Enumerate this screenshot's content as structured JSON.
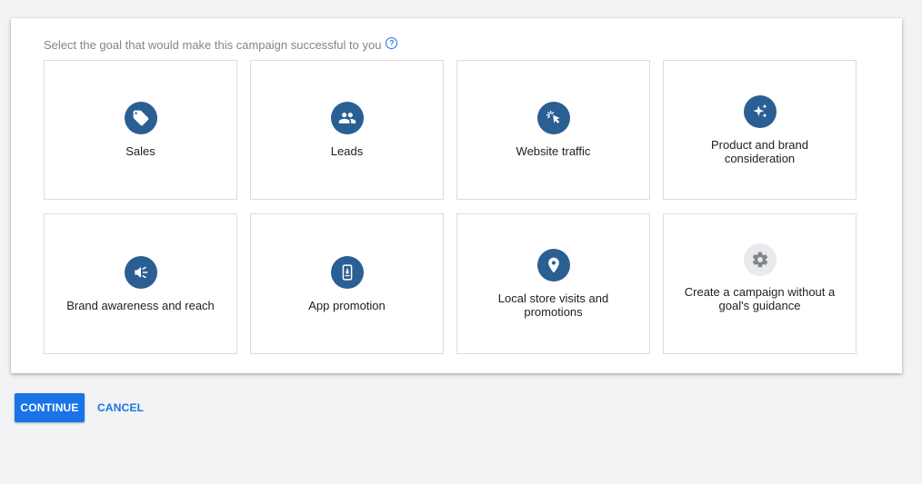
{
  "prompt": {
    "text": "Select the goal that would make this campaign successful to you",
    "help_glyph": "?"
  },
  "goals": [
    {
      "label": "Sales",
      "icon": "tag-icon"
    },
    {
      "label": "Leads",
      "icon": "people-icon"
    },
    {
      "label": "Website traffic",
      "icon": "cursor-click-icon"
    },
    {
      "label": "Product and brand consideration",
      "icon": "sparkle-icon"
    },
    {
      "label": "Brand awareness and reach",
      "icon": "megaphone-icon"
    },
    {
      "label": "App promotion",
      "icon": "phone-download-icon"
    },
    {
      "label": "Local store visits and promotions",
      "icon": "location-pin-icon"
    },
    {
      "label": "Create a campaign without a goal's guidance",
      "icon": "gear-icon"
    }
  ],
  "actions": {
    "continue_label": "CONTINUE",
    "cancel_label": "CANCEL"
  },
  "colors": {
    "accent": "#1a73e8",
    "icon_bg": "#2a5f94",
    "page_bg": "#f1f3f4"
  }
}
